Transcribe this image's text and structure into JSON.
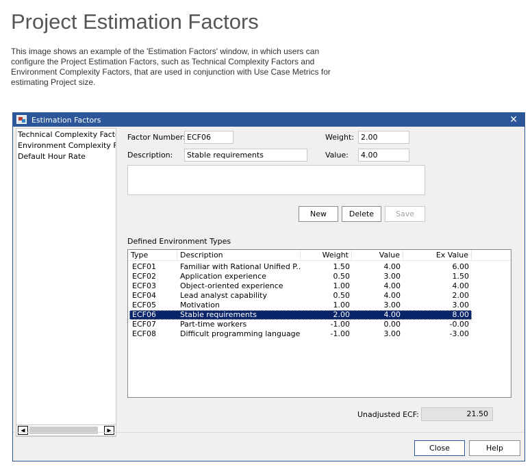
{
  "page": {
    "title": "Project Estimation Factors",
    "intro": "This image shows an example of the 'Estimation Factors' window, in which users can configure the Project Estimation Factors, such as Technical Complexity Factors and Environment Complexity Factors, that are used in conjunction with Use Case Metrics for estimating Project size."
  },
  "window": {
    "title": "Estimation Factors",
    "close_glyph": "✕"
  },
  "left_list": {
    "items": [
      "Technical Complexity Factors",
      "Environment Complexity Factors",
      "Default Hour Rate"
    ]
  },
  "scrollbar": {
    "left_arrow": "◀",
    "right_arrow": "▶"
  },
  "form": {
    "factor_number_label": "Factor Number:",
    "factor_number_value": "ECF06",
    "weight_label": "Weight:",
    "weight_value": "2.00",
    "description_label": "Description:",
    "description_value": "Stable requirements",
    "value_label": "Value:",
    "value_value": "4.00",
    "notes_value": ""
  },
  "buttons": {
    "new": "New",
    "delete": "Delete",
    "save": "Save",
    "close": "Close",
    "help": "Help"
  },
  "table": {
    "caption": "Defined Environment Types",
    "columns": [
      "Type",
      "Description",
      "Weight",
      "Value",
      "Ex Value"
    ],
    "rows": [
      {
        "type": "ECF01",
        "description": "Familiar with Rational Unified P...",
        "weight": "1.50",
        "value": "4.00",
        "ex_value": "6.00"
      },
      {
        "type": "ECF02",
        "description": "Application experience",
        "weight": "0.50",
        "value": "3.00",
        "ex_value": "1.50"
      },
      {
        "type": "ECF03",
        "description": "Object-oriented experience",
        "weight": "1.00",
        "value": "4.00",
        "ex_value": "4.00"
      },
      {
        "type": "ECF04",
        "description": "Lead analyst capability",
        "weight": "0.50",
        "value": "4.00",
        "ex_value": "2.00"
      },
      {
        "type": "ECF05",
        "description": "Motivation",
        "weight": "1.00",
        "value": "3.00",
        "ex_value": "3.00"
      },
      {
        "type": "ECF06",
        "description": "Stable requirements",
        "weight": "2.00",
        "value": "4.00",
        "ex_value": "8.00"
      },
      {
        "type": "ECF07",
        "description": "Part-time workers",
        "weight": "-1.00",
        "value": "0.00",
        "ex_value": "-0.00"
      },
      {
        "type": "ECF08",
        "description": "Difficult programming language",
        "weight": "-1.00",
        "value": "3.00",
        "ex_value": "-3.00"
      }
    ],
    "selected_type": "ECF06"
  },
  "summary": {
    "unadjusted_ecf_label": "Unadjusted ECF:",
    "unadjusted_ecf_value": "21.50"
  },
  "colors": {
    "titlebar": "#2b579a",
    "selection": "#0a246a",
    "heading_text": "#555555"
  }
}
